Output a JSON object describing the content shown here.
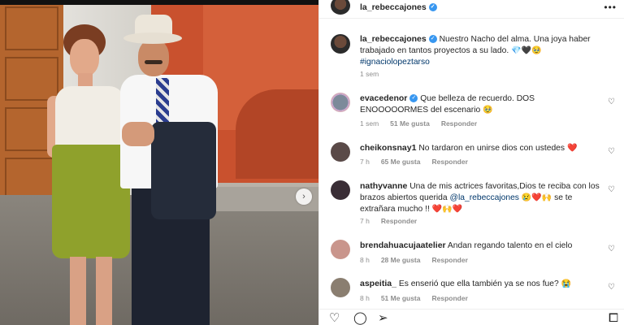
{
  "post": {
    "username": "la_rebeccajones",
    "more_icon": "more-icon"
  },
  "caption": {
    "username": "la_rebeccajones",
    "text": "Nuestro Nacho del alma. Una joya haber trabajado en tantos proyectos a su lado.",
    "emojis": "💎🖤🥹",
    "hashtag": "#ignaciolopeztarso",
    "time": "1 sem"
  },
  "comments": [
    {
      "username": "evacedenor",
      "verified": true,
      "text": "Que belleza de recuerdo. DOS ENOOOOORMES del escenario",
      "emoji": "🥹",
      "time": "1 sem",
      "likes": "51 Me gusta",
      "reply": "Responder",
      "avatar_color": "#7d8a9a"
    },
    {
      "username": "cheikonsnay1",
      "verified": false,
      "text": "No tardaron en unirse dios con ustedes",
      "emoji": "❤️",
      "time": "7 h",
      "likes": "65 Me gusta",
      "reply": "Responder",
      "avatar_color": "#5a4a48"
    },
    {
      "username": "nathyvanne",
      "verified": false,
      "text_before": "Una de mis actrices favoritas,Dios te reciba con los brazos abiertos querida",
      "mention": "@la_rebeccajones",
      "text_after": "se te extrañara mucho !!",
      "emoji_mid": "😢❤️🙌",
      "emoji_end": "❤️🙌❤️",
      "time": "7 h",
      "likes": "",
      "reply": "Responder",
      "avatar_color": "#3a2e36"
    },
    {
      "username": "brendahuacujaatelier",
      "verified": false,
      "text": "Andan regando talento en el cielo",
      "time": "8 h",
      "likes": "28 Me gusta",
      "reply": "Responder",
      "avatar_color": "#c9958c"
    },
    {
      "username": "aspeitia_",
      "verified": false,
      "text": "Es enserió que ella también ya se nos fue?",
      "emoji": "😭",
      "time": "8 h",
      "likes": "51 Me gusta",
      "reply": "Responder",
      "avatar_color": "#8a7e70"
    }
  ],
  "actions": {
    "like_icon": "heart-icon",
    "comment_icon": "comment-icon",
    "share_icon": "share-icon",
    "save_icon": "bookmark-icon"
  }
}
